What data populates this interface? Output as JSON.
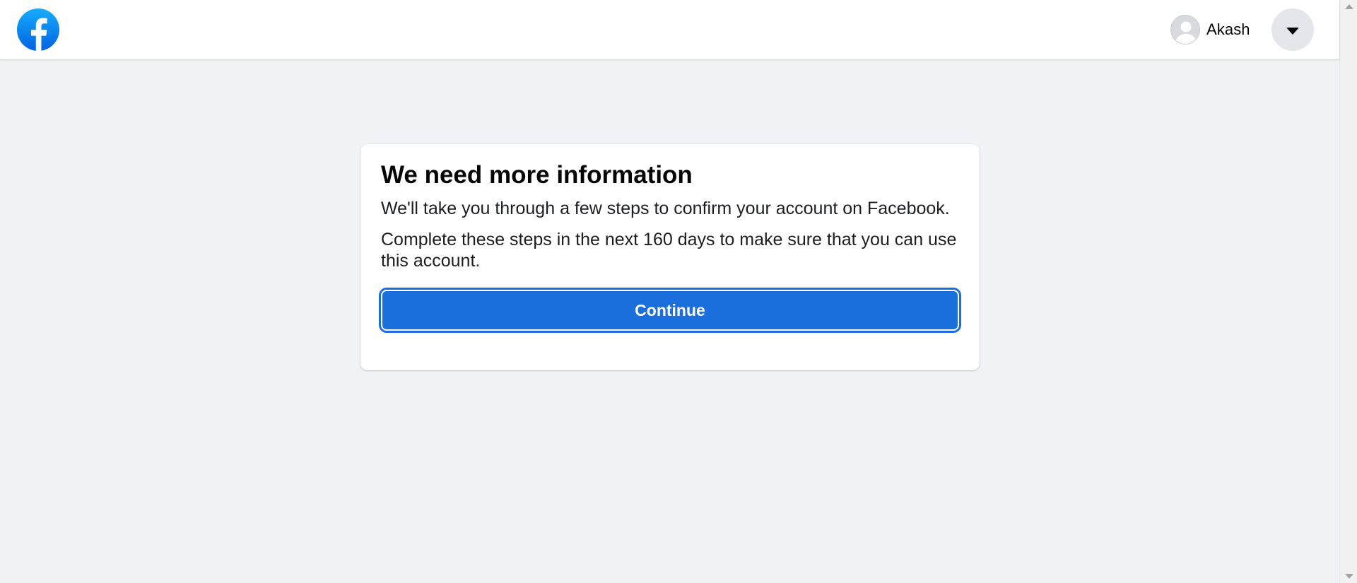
{
  "header": {
    "logo_icon": "facebook-logo-icon",
    "brand_color": "#1877f2",
    "profile": {
      "name": "Akash",
      "avatar_icon": "default-avatar-icon"
    },
    "menu_icon": "caret-down-icon"
  },
  "card": {
    "title": "We need more information",
    "paragraph1": "We'll take you through a few steps to confirm your account on Facebook.",
    "paragraph2": "Complete these steps in the next 160 days to make sure that you can use this account.",
    "continue_label": "Continue",
    "button_color": "#1b6fdc"
  },
  "scrollbar": {
    "up_icon": "scroll-up-arrow-icon",
    "down_icon": "scroll-down-arrow-icon"
  }
}
